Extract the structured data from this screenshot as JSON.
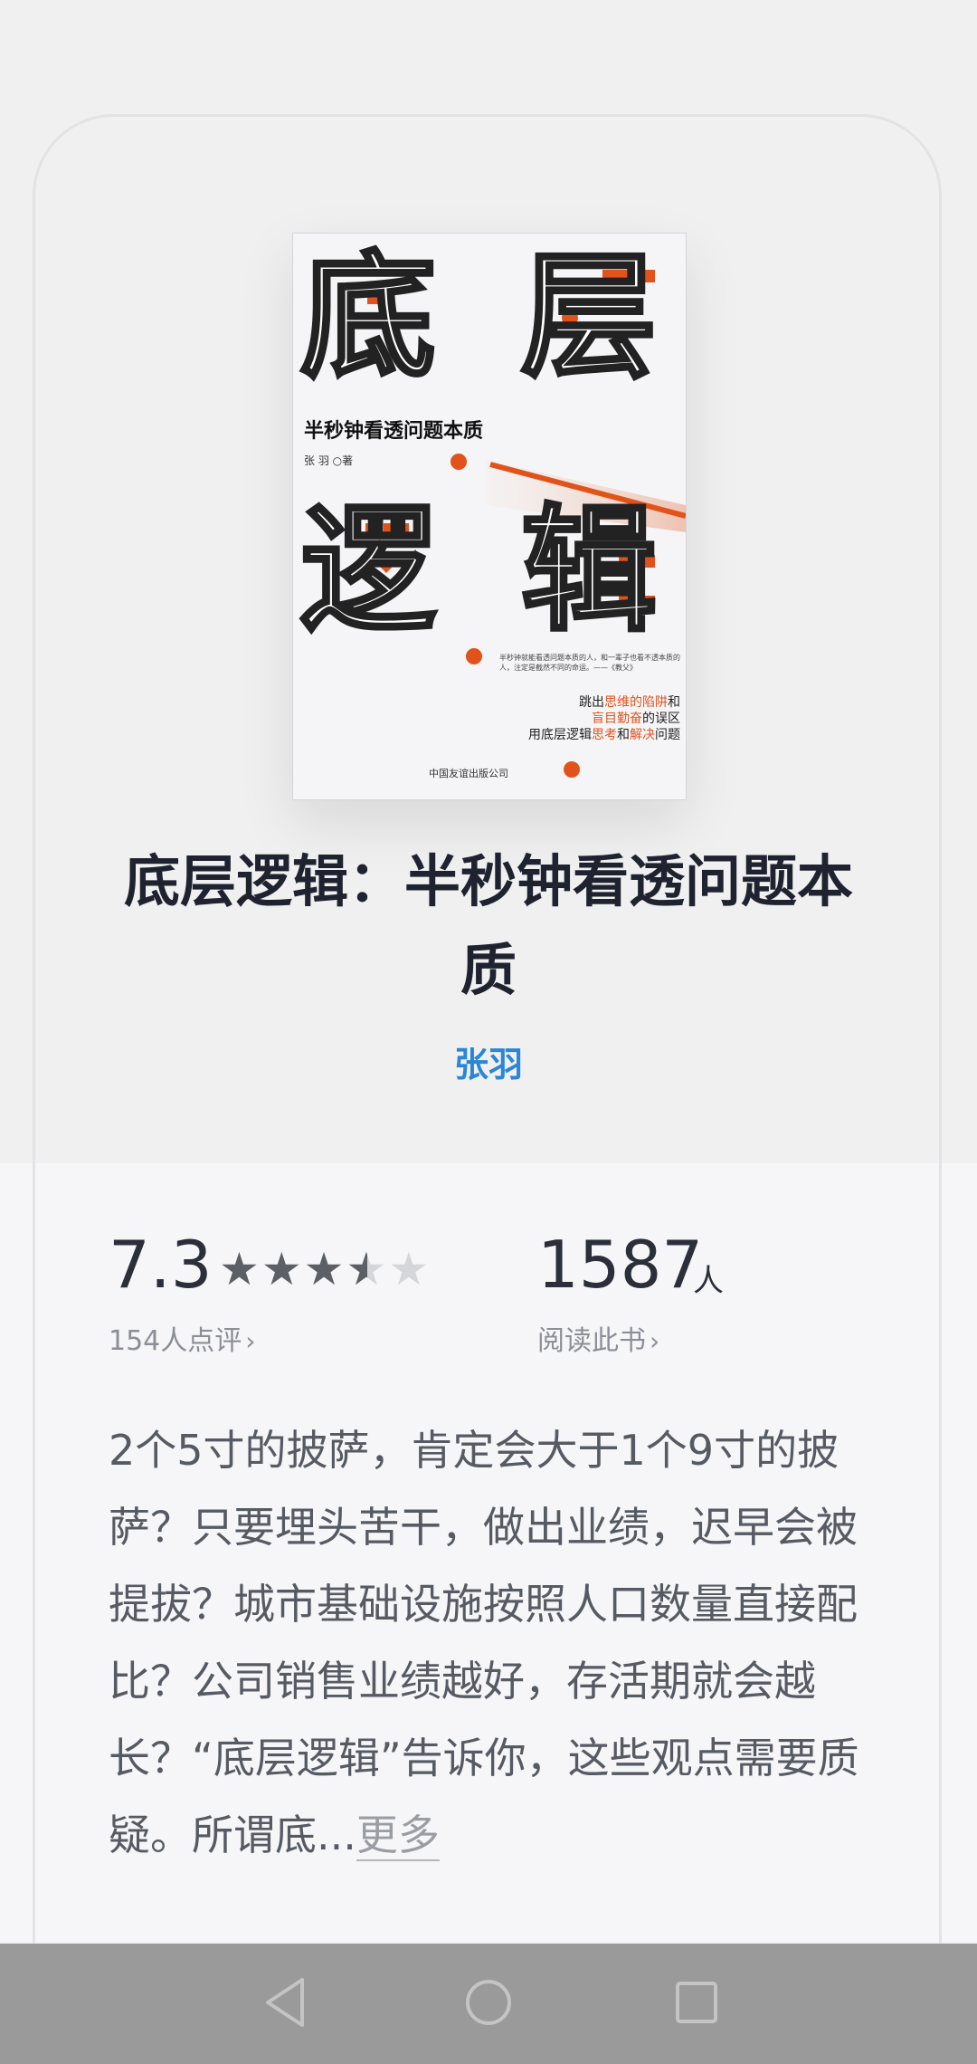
{
  "cover": {
    "big_chars": [
      "底",
      "层",
      "逻",
      "辑"
    ],
    "subtitle": "半秒钟看透问题本质",
    "author_line": "张 羽 ○著",
    "quote": "半秒钟就能看透问题本质的人，和一辈子也看不透本质的人，注定是截然不同的命运。——《教父》",
    "tag_line1_a": "跳出",
    "tag_line1_hl": "思维的陷阱",
    "tag_line1_b": "和",
    "tag_line2_hl": "盲目勤奋",
    "tag_line2_b": "的误区",
    "tag_line3_a": "用底层逻辑",
    "tag_line3_hl1": "思考",
    "tag_line3_b": "和",
    "tag_line3_hl2": "解决",
    "tag_line3_c": "问题",
    "publisher": "中国友谊出版公司",
    "accent_color": "#e2531b"
  },
  "book": {
    "title": "底层逻辑：半秒钟看透问题本质",
    "author": "张羽"
  },
  "stats": {
    "score": "7.3",
    "rating_stars": 3.5,
    "rating_count": "154人点评",
    "readers": "1587",
    "readers_unit": "人",
    "readers_label": "阅读此书"
  },
  "description": {
    "text": "2个5寸的披萨，肯定会大于1个9寸的披萨？只要埋头苦干，做出业绩，迟早会被提拔？城市基础设施按照人口数量直接配比？公司销售业绩越好，存活期就会越长？“底层逻辑”告诉你，这些观点需要质疑。所谓底...",
    "more_label": "更多"
  },
  "navbar": {
    "icons": [
      "back-triangle-icon",
      "home-circle-icon",
      "recent-square-icon"
    ]
  }
}
